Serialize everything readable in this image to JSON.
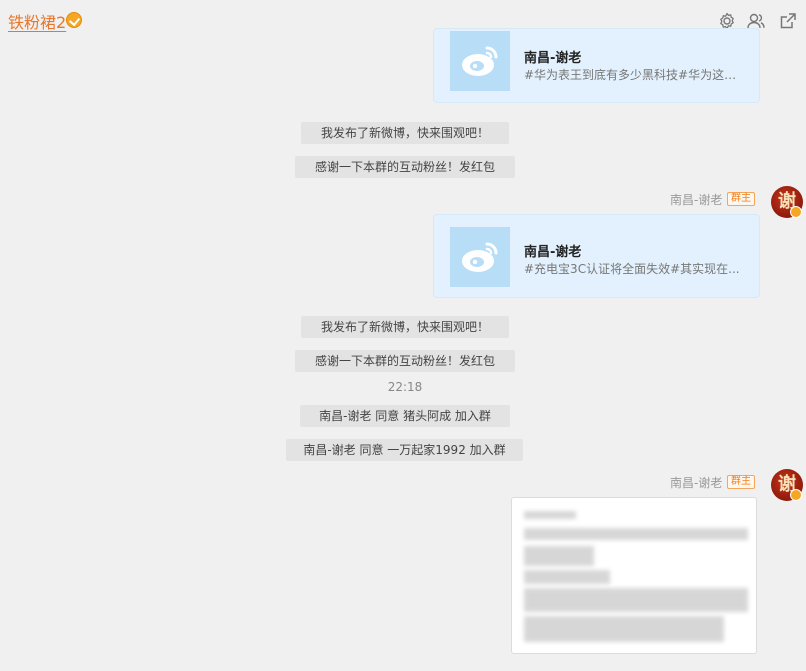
{
  "header": {
    "title": "铁粉裙2",
    "icons": [
      "settings-icon",
      "members-icon",
      "open-external-icon"
    ]
  },
  "messages": [
    {
      "type": "share_card",
      "title": "南昌-谢老",
      "desc": "#华为表王到底有多少黑科技#华为这个..."
    },
    {
      "type": "system",
      "text": "我发布了新微博，快来围观吧！"
    },
    {
      "type": "system",
      "text": "感谢一下本群的互动粉丝！发红包"
    },
    {
      "type": "sender",
      "name": "南昌-谢老",
      "badge": "群主",
      "avatar_char": "谢"
    },
    {
      "type": "share_card",
      "title": "南昌-谢老",
      "desc": "#充电宝3C认证将全面失效#其实现在..."
    },
    {
      "type": "system",
      "text": "我发布了新微博，快来围观吧！"
    },
    {
      "type": "system",
      "text": "感谢一下本群的互动粉丝！发红包"
    },
    {
      "type": "time",
      "text": "22:18"
    },
    {
      "type": "system",
      "text": "南昌-谢老 同意 猪头阿成 加入群"
    },
    {
      "type": "system",
      "text": "南昌-谢老 同意 一万起家1992 加入群"
    },
    {
      "type": "sender",
      "name": "南昌-谢老",
      "badge": "群主",
      "avatar_char": "谢"
    },
    {
      "type": "image",
      "note": "blurred-screenshot"
    }
  ],
  "colors": {
    "accent": "#e8762d",
    "card_bg": "#e2f1fd",
    "page_bg": "#f0f0f0"
  }
}
